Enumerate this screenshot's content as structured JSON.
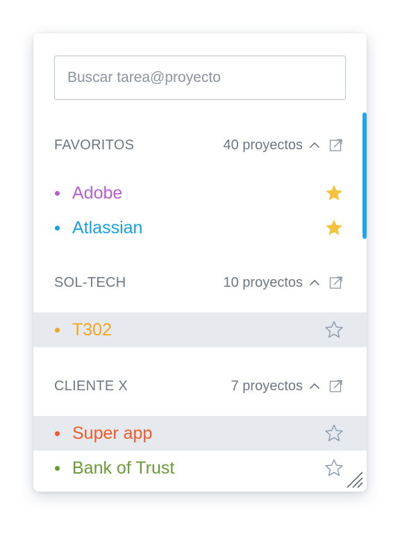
{
  "search": {
    "placeholder": "Buscar tarea@proyecto",
    "value": ""
  },
  "colors": {
    "accent": "#1ea5ee",
    "star_filled": "#f3c33b",
    "star_outline": "#8797a8",
    "highlight": "#e6eaee",
    "header_text": "#6b7785"
  },
  "sections": [
    {
      "title": "FAVORITOS",
      "count": "40 proyectos",
      "items": [
        {
          "label": "Adobe",
          "color": "#b85fd2",
          "starred": true
        },
        {
          "label": "Atlassian",
          "color": "#15a2e6",
          "starred": true
        }
      ]
    },
    {
      "title": "SOL-TECH",
      "count": "10 proyectos",
      "items": [
        {
          "label": "T302",
          "color": "#f4a41e",
          "starred": false,
          "highlighted": true
        }
      ]
    },
    {
      "title": "CLIENTE X",
      "count": "7 proyectos",
      "items": [
        {
          "label": "Super app",
          "color": "#f35a28",
          "starred": false,
          "highlighted": true
        },
        {
          "label": "Bank of Trust",
          "color": "#6a9b36",
          "starred": false
        }
      ]
    }
  ],
  "icons": [
    "chevron-up-icon",
    "external-link-icon",
    "star-filled-icon",
    "star-outline-icon",
    "resize-handle-icon"
  ]
}
